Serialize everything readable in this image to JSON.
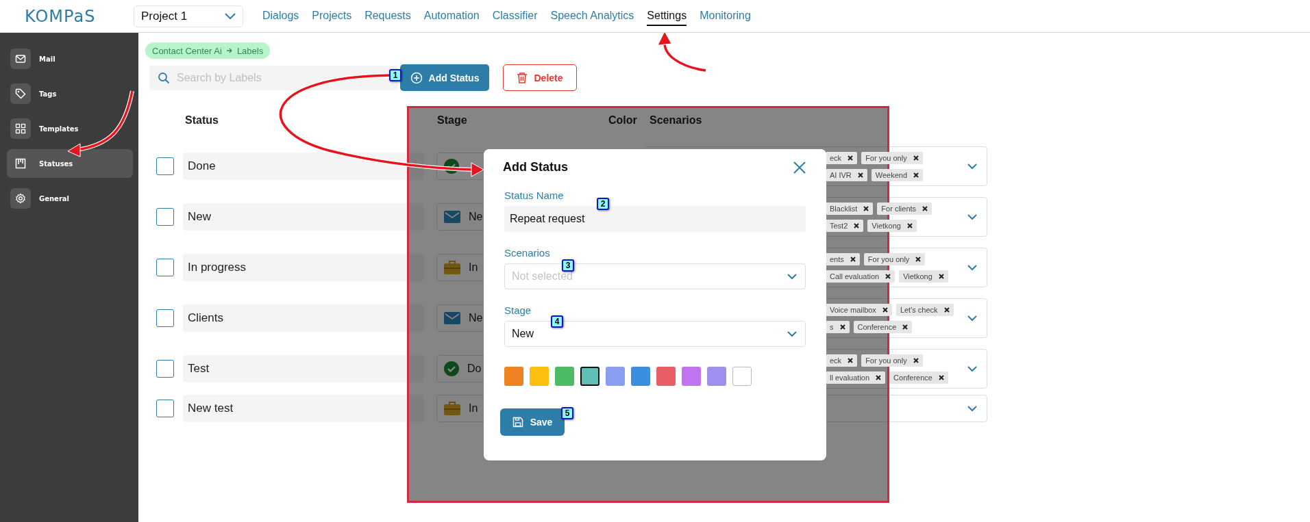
{
  "header": {
    "logo": "KOMPaS",
    "project": "Project 1"
  },
  "nav": [
    {
      "label": "Dialogs",
      "selected": false
    },
    {
      "label": "Projects",
      "selected": false
    },
    {
      "label": "Requests",
      "selected": false
    },
    {
      "label": "Automation",
      "selected": false
    },
    {
      "label": "Classifier",
      "selected": false
    },
    {
      "label": "Speech Analytics",
      "selected": false
    },
    {
      "label": "Settings",
      "selected": true
    },
    {
      "label": "Monitoring",
      "selected": false
    }
  ],
  "sidebar": [
    {
      "label": "Mail",
      "selected": false
    },
    {
      "label": "Tags",
      "selected": false
    },
    {
      "label": "Templates",
      "selected": false
    },
    {
      "label": "Statuses",
      "selected": true
    },
    {
      "label": "General",
      "selected": false
    }
  ],
  "breadcrumb": [
    "Contact Center Ai",
    "Labels"
  ],
  "search": {
    "placeholder": "Search by Labels"
  },
  "buttons": [
    {
      "label": "Add Status",
      "kind": "add"
    },
    {
      "label": "Delete",
      "kind": "delete"
    }
  ],
  "table": {
    "columns": [
      "Status",
      "Stage",
      "Color",
      "Scenarios"
    ],
    "rows": [
      {
        "status": "Done",
        "checked": false,
        "kind": "done",
        "tag_lines": [
          [
            "eck",
            "For you only"
          ],
          [
            "AI IVR",
            "Weekend"
          ]
        ]
      },
      {
        "status": "New",
        "checked": false,
        "kind": "new",
        "stage": "Ne",
        "tag_lines": [
          [
            "Blacklist",
            "For clients"
          ],
          [
            "Test2",
            "Vietkong"
          ]
        ]
      },
      {
        "status": "In progress",
        "checked": false,
        "kind": "progress",
        "stage": "In",
        "tag_lines": [
          [
            "ents",
            "For you only"
          ],
          [
            "Call evaluation",
            "Vietkong"
          ]
        ]
      },
      {
        "status": "Clients",
        "checked": false,
        "kind": "new",
        "stage": "Ne",
        "tag_lines": [
          [
            "Voice mailbox",
            "Let's check"
          ],
          [
            "s",
            "Conference"
          ]
        ]
      },
      {
        "status": "Test",
        "checked": false,
        "kind": "done",
        "stage": "Do",
        "tag_lines": [
          [
            "eck",
            "For you only"
          ],
          [
            "ll evaluation",
            "Conference"
          ]
        ]
      },
      {
        "status": "New test",
        "checked": false,
        "kind": "progress",
        "stage": "In"
      }
    ]
  },
  "dialog": {
    "title": "Add Status",
    "status_name": {
      "label": "Status Name",
      "value": "Repeat request"
    },
    "scenarios": {
      "label": "Scenarios",
      "placeholder": "Not selected"
    },
    "stage": {
      "label": "Stage",
      "value": "New"
    },
    "colors": [
      {
        "color": "#ef8322",
        "selected": false
      },
      {
        "color": "#fdbf0f",
        "selected": false
      },
      {
        "color": "#4cbb63",
        "selected": false
      },
      {
        "color": "#5ebfb5",
        "selected": true
      },
      {
        "color": "#8a9ef0",
        "selected": false
      },
      {
        "color": "#3b8fde",
        "selected": false
      },
      {
        "color": "#e95d66",
        "selected": false
      },
      {
        "color": "#c074ef",
        "selected": false
      },
      {
        "color": "#9f90ee",
        "selected": false
      },
      {
        "color": "#ffffff",
        "selected": false
      }
    ],
    "save": "Save"
  },
  "callouts": [
    "1",
    "2",
    "3",
    "4",
    "5"
  ]
}
